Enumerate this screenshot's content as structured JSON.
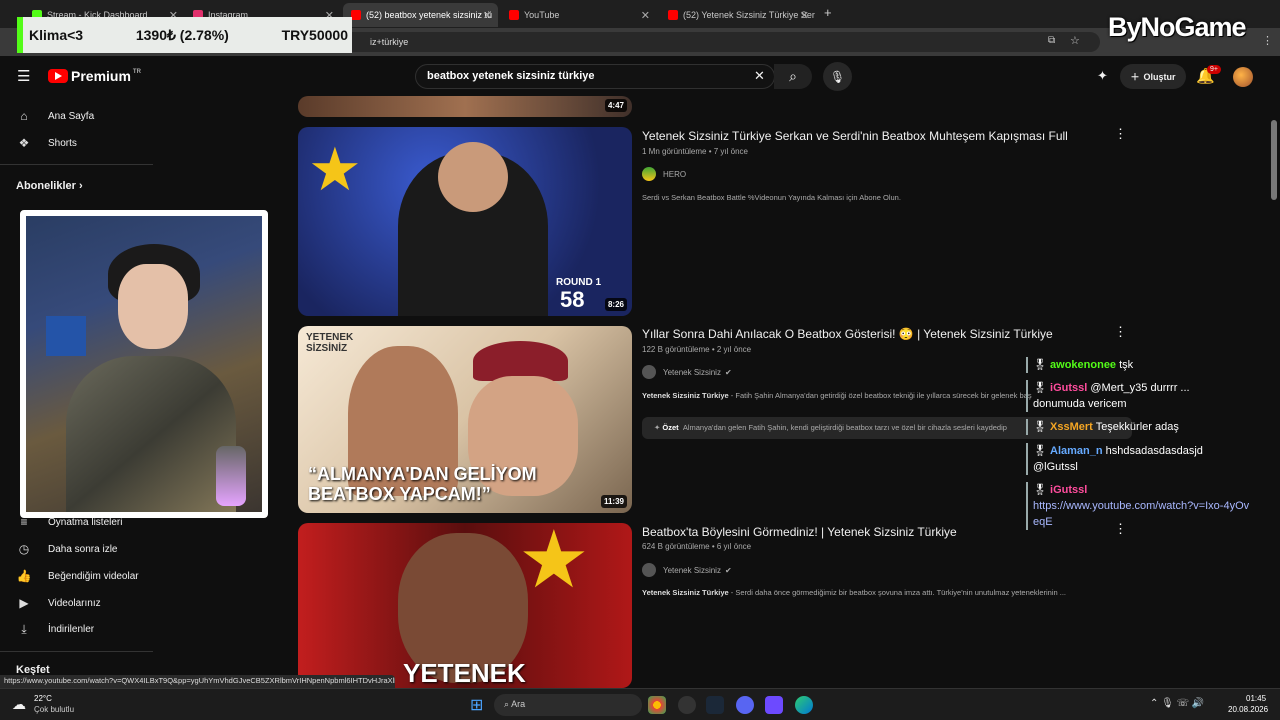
{
  "browser": {
    "tabs": [
      {
        "label": "Stream - Kick Dashboard",
        "color": "#53fc18"
      },
      {
        "label": "Instagram",
        "color": "#e1306c"
      },
      {
        "label": "(52) beatbox yetenek sizsiniz tü",
        "color": "#ff0000"
      },
      {
        "label": "YouTube",
        "color": "#ff0000"
      },
      {
        "label": "(52) Yetenek Sizsiniz Türkiye Ser",
        "color": "#ff0000"
      }
    ],
    "new_tab": "+",
    "url": "iz+türkiye"
  },
  "overlay": {
    "klima_name": "Klima<3",
    "klima_change": "1390₺ (2.78%)",
    "klima_goal": "TRY50000",
    "brand": "ByNoGame"
  },
  "youtube": {
    "logo_text": "Premium",
    "logo_region": "TR",
    "search_value": "beatbox yetenek sizsiniz türkiye",
    "create_label": "Oluştur",
    "notif_count": "9+"
  },
  "sidebar": {
    "top": [
      {
        "label": "Ana Sayfa",
        "icon": "home-icon"
      },
      {
        "label": "Shorts",
        "icon": "shorts-icon"
      }
    ],
    "subs_head": "Abonelikler",
    "you_items": [
      {
        "label": "Oynatma listeleri",
        "icon": "playlist-icon"
      },
      {
        "label": "Daha sonra izle",
        "icon": "clock-icon"
      },
      {
        "label": "Beğendiğim videolar",
        "icon": "like-icon"
      },
      {
        "label": "Videolarınız",
        "icon": "video-icon"
      },
      {
        "label": "İndirilenler",
        "icon": "download-icon"
      }
    ],
    "explore_head": "Keşfet"
  },
  "results": [
    {
      "duration": "4:47"
    },
    {
      "title": "Yetenek Sizsiniz Türkiye Serkan ve Serdi'nin Beatbox Muhteşem Kapışması Full",
      "meta": "1 Mn görüntüleme • 7 yıl önce",
      "channel": "HERO",
      "desc": "Serdi vs Serkan Beatbox Battle %Videonun Yayında Kalması için Abone Olun.",
      "duration": "8:26",
      "thumb_text": "ROUND 1",
      "thumb_num": "58"
    },
    {
      "title": "Yıllar Sonra Dahi Anılacak O Beatbox Gösterisi! 😳 | Yetenek Sizsiniz Türkiye",
      "meta": "122 B görüntüleme • 2 yıl önce",
      "channel": "Yetenek Sizsiniz",
      "desc_bold": "Yetenek Sizsiniz Türkiye",
      "desc": " - Fatih Şahin Almanya'dan getirdiği özel beatbox tekniği ile yıllarca sürecek bir gelenek başlatıyor!",
      "ozet_label": "Özet",
      "ozet_text": "Almanya'dan gelen Fatih Şahin, kendi geliştirdiği beatbox tarzı ve özel bir cihazla sesleri kaydedip",
      "duration": "11:39",
      "thumb_text": "“ALMANYA'DAN GELİYOM BEATBOX YAPCAM!”",
      "thumb_logo": "YETENEK SİZSİNİZ"
    },
    {
      "title": "Beatbox'ta Böylesini Görmediniz! | Yetenek Sizsiniz Türkiye",
      "meta": "624 B görüntüleme • 6 yıl önce",
      "channel": "Yetenek Sizsiniz",
      "desc_bold": "Yetenek Sizsiniz Türkiye",
      "desc": " - Serdi daha önce görmediğimiz bir beatbox şovuna imza attı. Türkiye'nin unutulmaz yeteneklerinin ...",
      "thumb_text": "YETENEK"
    }
  ],
  "chat": [
    {
      "user": "awokenonee",
      "msg": "tşk",
      "color": "#53fc18"
    },
    {
      "user": "iGutssl",
      "msg": "@Mert_y35 durrrr ... donumuda vericem",
      "color": "#ff4d9d"
    },
    {
      "user": "XssMert",
      "msg": "Teşekkürler adaş",
      "color": "#f5a623"
    },
    {
      "user": "Alaman_n",
      "msg": "hshdsadasdasdasjd @lGutssl",
      "color": "#66aaff"
    },
    {
      "user": "iGutssl",
      "msg": "https://www.youtube.com/watch?v=Ixo-4yOveqE",
      "color": "#ff4d9d"
    }
  ],
  "status_url": "https://www.youtube.com/watch?v=QWX4ILBxT9Q&pp=ygUhYmVhdGJveCB5ZXRlbmVrIHNpenNpbml6IHTDvHJraXll...",
  "taskbar": {
    "temp": "22°C",
    "weather": "Çok bulutlu",
    "search": "Ara",
    "time": "01:45",
    "date": "20.08.2026"
  }
}
